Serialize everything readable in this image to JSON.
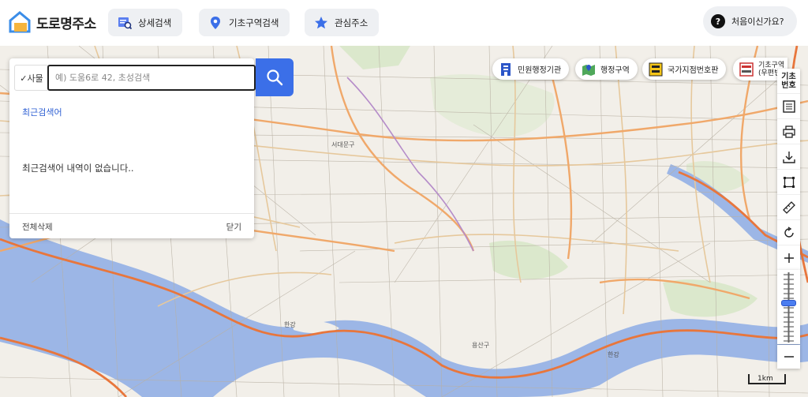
{
  "header": {
    "logo_text": "도로명주소",
    "nav": [
      {
        "label": "상세검색",
        "icon": "detail-search-icon"
      },
      {
        "label": "기초구역검색",
        "icon": "location-pin-icon"
      },
      {
        "label": "관심주소",
        "icon": "star-icon"
      }
    ],
    "help_label": "처음이신가요?",
    "help_icon_text": "?"
  },
  "search": {
    "filter_label": "✓사물",
    "placeholder": "예) 도움6로 42, 초성검색",
    "value": "",
    "recent_title": "최근검색어",
    "empty_message": "최근검색어 내역이 없습니다..",
    "delete_all_label": "전체삭제",
    "close_label": "닫기"
  },
  "layers": [
    {
      "label": "민원행정기관",
      "icon": "building-icon"
    },
    {
      "label": "행정구역",
      "icon": "map-region-icon"
    },
    {
      "label": "국가지점번호판",
      "icon": "point-sign-icon"
    },
    {
      "label": "기초구역\n(우편번",
      "icon": "postal-zone-icon"
    }
  ],
  "tools": {
    "basic_number_label": "기초\n번호"
  },
  "map": {
    "labels": [
      "한강",
      "한강",
      "용산구",
      "서대문구"
    ],
    "scale_label": "1km"
  },
  "colors": {
    "accent": "#3b6fe8",
    "water": "#9cb6e6",
    "land": "#f2efe9",
    "major_road": "#f0a86a",
    "expressway": "#e8763c"
  }
}
